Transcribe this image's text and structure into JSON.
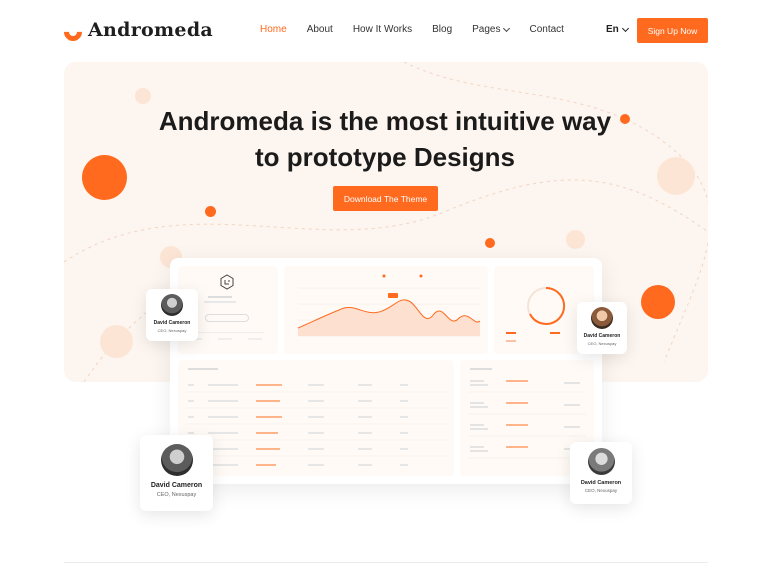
{
  "brand": {
    "name": "Andromeda"
  },
  "nav": {
    "items": [
      {
        "label": "Home",
        "active": true
      },
      {
        "label": "About",
        "active": false
      },
      {
        "label": "How It Works",
        "active": false
      },
      {
        "label": "Blog",
        "active": false
      },
      {
        "label": "Pages",
        "active": false,
        "dropdown": true
      },
      {
        "label": "Contact",
        "active": false
      }
    ],
    "language": "En",
    "signup_label": "Sign Up Now"
  },
  "hero": {
    "title_line1": "Andromeda is the most intuitive way",
    "title_line2": "to prototype Designs",
    "cta_label": "Download The Theme"
  },
  "cards": [
    {
      "name": "David Cameron",
      "role": "CEO, Nexuspay"
    },
    {
      "name": "David Cameron",
      "role": "CEO, Nexuspay"
    },
    {
      "name": "David Cameron",
      "role": "CEO, Nexuspay"
    },
    {
      "name": "David Cameron",
      "role": "CEO, Nexuspay"
    }
  ],
  "colors": {
    "accent": "#ff6a1f",
    "hero_bg": "#fdf5ef",
    "pale_circle": "#fde5d6"
  }
}
